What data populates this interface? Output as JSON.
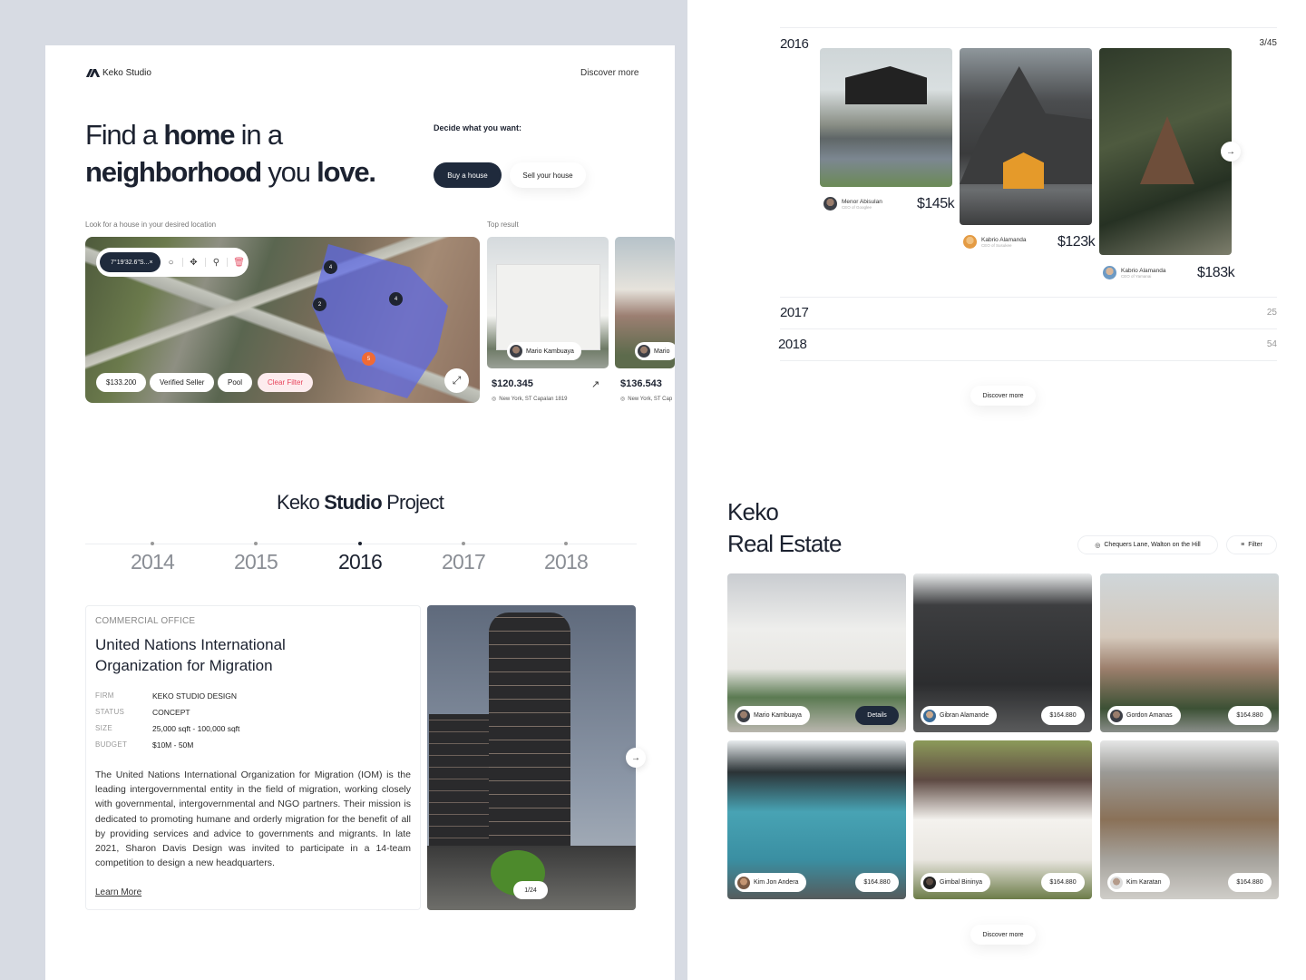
{
  "brand": {
    "name": "Keko Studio"
  },
  "header": {
    "discover_more": "Discover more"
  },
  "hero": {
    "line1_a": "Find a ",
    "line1_b": "home",
    "line1_c": " in a",
    "line2_a": "neighborhood",
    "line2_b": " you ",
    "line2_c": "love."
  },
  "decide": {
    "label": "Decide what you want:",
    "buy_label": "Buy a house",
    "sell_label": "Sell your house"
  },
  "map_section": {
    "label": "Look for a house in your desired location",
    "search_value": "7°19'32.6\"S...",
    "clear_icon": "×",
    "pins": [
      "4",
      "2",
      "4",
      "5"
    ],
    "filters": [
      "$133.200",
      "Verified Seller",
      "Pool"
    ],
    "clear_filter": "Clear Filter"
  },
  "top_result": {
    "label": "Top result",
    "items": [
      {
        "agent": "Mario Kambuaya",
        "price": "$120.345",
        "address": "New York, ST Capalan 1819"
      },
      {
        "agent": "Mario",
        "price": "$136.543",
        "address": "New York, ST Cap"
      }
    ]
  },
  "project": {
    "title_a": "Keko ",
    "title_b": "Studio",
    "title_c": " Project",
    "years": [
      "2014",
      "2015",
      "2016",
      "2017",
      "2018"
    ],
    "active_year": "2016",
    "category": "COMMERCIAL OFFICE",
    "name": "United Nations International Organization for Migration",
    "specs": [
      {
        "key": "FIRM",
        "value": "KEKO STUDIO DESIGN"
      },
      {
        "key": "STATUS",
        "value": "CONCEPT"
      },
      {
        "key": "SIZE",
        "value": "25,000 sqft - 100,000 sqft"
      },
      {
        "key": "BUDGET",
        "value": "$10M - 50M"
      }
    ],
    "description": "The United Nations International Organization for Migration (IOM) is the leading intergovernmental entity in the field of migration, working closely with governmental, intergovernmental and NGO partners. Their mission is dedicated to promoting humane and orderly migration for the benefit of all by providing services and advice to governments and migrants. In late 2021, Sharon Davis Design was invited to participate in a 14-team competition to design a new headquarters.",
    "learn_more": "Learn More",
    "image_counter": "1/24"
  },
  "gallery": {
    "year": "2016",
    "page": "3/45",
    "items": [
      {
        "owner": "Menor Abisulan",
        "role": "CEO of Googlee",
        "price": "$145k"
      },
      {
        "owner": "Kabrio Alamanda",
        "role": "CEO of Susukee",
        "price": "$123k"
      },
      {
        "owner": "Kabrio Alamanda",
        "role": "CEO of Yamanai",
        "price": "$183k"
      }
    ],
    "other_years": [
      {
        "year": "2017",
        "count": "25"
      },
      {
        "year": "2018",
        "count": "54"
      }
    ],
    "discover_more": "Discover more"
  },
  "real_estate": {
    "title_l1": "Keko",
    "title_l2": "Real Estate",
    "location": "Chequers Lane, Walton on the Hill",
    "filter": "Filter",
    "listings": [
      {
        "agent": "Mario Kambuaya",
        "action": "Details"
      },
      {
        "agent": "Gibran Alamande",
        "price": "$164.880"
      },
      {
        "agent": "Gordon Amanas",
        "price": "$164.880"
      },
      {
        "agent": "Kim Jon Andera",
        "price": "$164.880"
      },
      {
        "agent": "Gimbal Bininya",
        "price": "$164.880"
      },
      {
        "agent": "Kim Karatan",
        "price": "$164.880"
      }
    ],
    "discover_more": "Discover more"
  }
}
